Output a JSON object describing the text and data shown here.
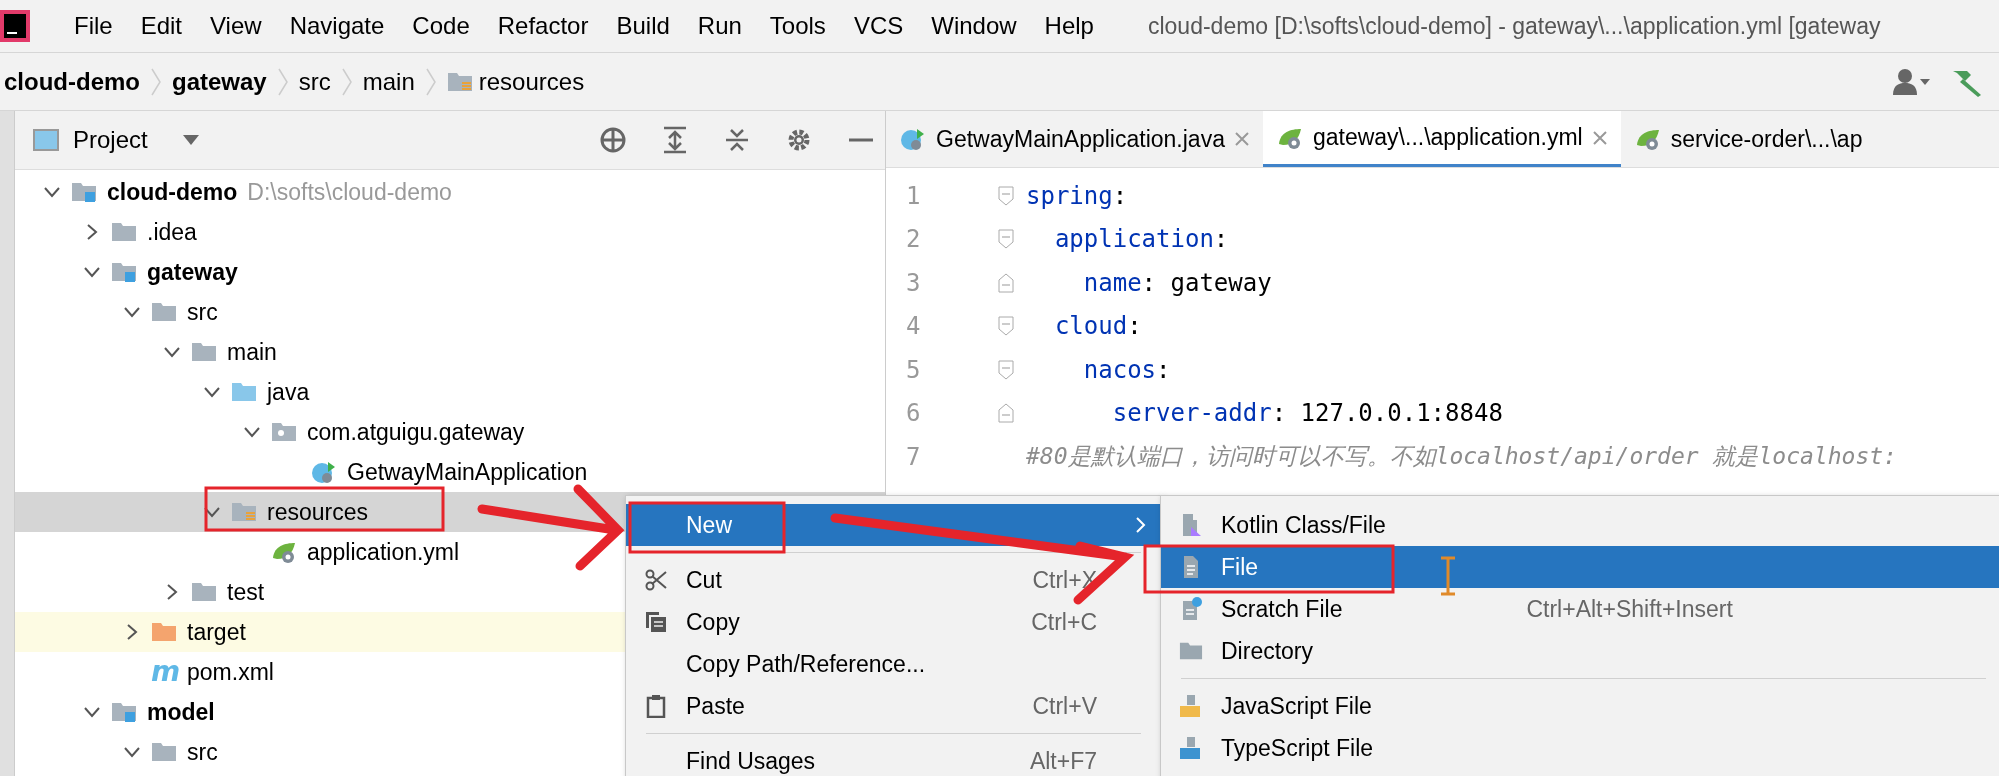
{
  "window": {
    "title": "cloud-demo [D:\\softs\\cloud-demo] - gateway\\...\\application.yml [gateway"
  },
  "menu": [
    "File",
    "Edit",
    "View",
    "Navigate",
    "Code",
    "Refactor",
    "Build",
    "Run",
    "Tools",
    "VCS",
    "Window",
    "Help"
  ],
  "breadcrumb": [
    {
      "label": "cloud-demo",
      "kind": "module"
    },
    {
      "label": "gateway",
      "kind": "module"
    },
    {
      "label": "src",
      "kind": "plain"
    },
    {
      "label": "main",
      "kind": "plain"
    },
    {
      "label": "resources",
      "kind": "resources"
    }
  ],
  "project_panel": {
    "title": "Project",
    "tree": [
      {
        "label": "cloud-demo",
        "kind": "module",
        "path": "D:\\softs\\cloud-demo",
        "expanded": true,
        "selected": false,
        "children": [
          {
            "label": ".idea",
            "kind": "folder",
            "expanded": false,
            "selected": false
          },
          {
            "label": "gateway",
            "kind": "module",
            "expanded": true,
            "selected": false,
            "children": [
              {
                "label": "src",
                "kind": "folder",
                "expanded": true,
                "selected": false,
                "children": [
                  {
                    "label": "main",
                    "kind": "folder",
                    "expanded": true,
                    "selected": false,
                    "children": [
                      {
                        "label": "java",
                        "kind": "source",
                        "expanded": true,
                        "selected": false,
                        "children": [
                          {
                            "label": "com.atguigu.gateway",
                            "kind": "package",
                            "expanded": true,
                            "selected": false,
                            "children": [
                              {
                                "label": "GetwayMainApplication",
                                "kind": "class",
                                "selected": false
                              }
                            ]
                          }
                        ]
                      },
                      {
                        "label": "resources",
                        "kind": "resources",
                        "expanded": true,
                        "selected": true,
                        "children": [
                          {
                            "label": "application.yml",
                            "kind": "yml",
                            "selected": false
                          }
                        ]
                      }
                    ]
                  },
                  {
                    "label": "test",
                    "kind": "folder",
                    "expanded": false,
                    "selected": false
                  }
                ]
              },
              {
                "label": "target",
                "kind": "excluded",
                "expanded": false,
                "selected": false
              },
              {
                "label": "pom.xml",
                "kind": "maven",
                "icon_label": "m",
                "selected": false
              }
            ]
          },
          {
            "label": "model",
            "kind": "module",
            "expanded": true,
            "selected": false,
            "children": [
              {
                "label": "src",
                "kind": "folder",
                "expanded": true,
                "selected": false
              }
            ]
          }
        ]
      }
    ]
  },
  "editor": {
    "tabs": [
      {
        "label": "GetwayMainApplication.java",
        "kind": "class",
        "selected": false
      },
      {
        "label": "gateway\\...\\application.yml",
        "kind": "yml",
        "selected": true
      },
      {
        "label": "service-order\\...\\ap",
        "kind": "yml",
        "selected": false
      }
    ],
    "lines": [
      {
        "number": "1",
        "key": "spring",
        "punct": ":",
        "children": [
          {
            "number": "2",
            "key": "application",
            "punct": ":",
            "children": [
              {
                "number": "3",
                "key": "name",
                "punct": ":",
                "value": "gateway"
              }
            ]
          },
          {
            "number": "4",
            "key": "cloud",
            "punct": ":",
            "children": [
              {
                "number": "5",
                "key": "nacos",
                "punct": ":",
                "children": [
                  {
                    "number": "6",
                    "key": "server-addr",
                    "punct": ":",
                    "value": "127.0.0.1:8848"
                  }
                ]
              }
            ]
          }
        ]
      },
      {
        "number": "7",
        "comment": "#80是默认端口，访问时可以不写。不如localhost/api/order 就是localhost:"
      }
    ]
  },
  "context_menu": {
    "items": [
      {
        "kind": "submenu",
        "label": "New",
        "selected": true
      },
      {
        "kind": "separator"
      },
      {
        "kind": "cut",
        "label": "Cut",
        "shortcut": "Ctrl+X",
        "selected": false
      },
      {
        "kind": "copy",
        "label": "Copy",
        "shortcut": "Ctrl+C",
        "selected": false
      },
      {
        "kind": "item",
        "label": "Copy Path/Reference...",
        "selected": false
      },
      {
        "kind": "paste",
        "label": "Paste",
        "shortcut": "Ctrl+V",
        "selected": false
      },
      {
        "kind": "separator"
      },
      {
        "kind": "item",
        "label": "Find Usages",
        "shortcut": "Alt+F7",
        "selected": false
      }
    ]
  },
  "submenu": {
    "items": [
      {
        "kind": "kotlin",
        "label": "Kotlin Class/File",
        "selected": false
      },
      {
        "kind": "file",
        "label": "File",
        "selected": true
      },
      {
        "kind": "scratch",
        "label": "Scratch File",
        "shortcut": "Ctrl+Alt+Shift+Insert",
        "selected": false
      },
      {
        "kind": "folder",
        "label": "Directory",
        "selected": false
      },
      {
        "kind": "separator"
      },
      {
        "kind": "js",
        "label": "JavaScript File",
        "selected": false
      },
      {
        "kind": "ts",
        "label": "TypeScript File",
        "selected": false
      }
    ]
  }
}
